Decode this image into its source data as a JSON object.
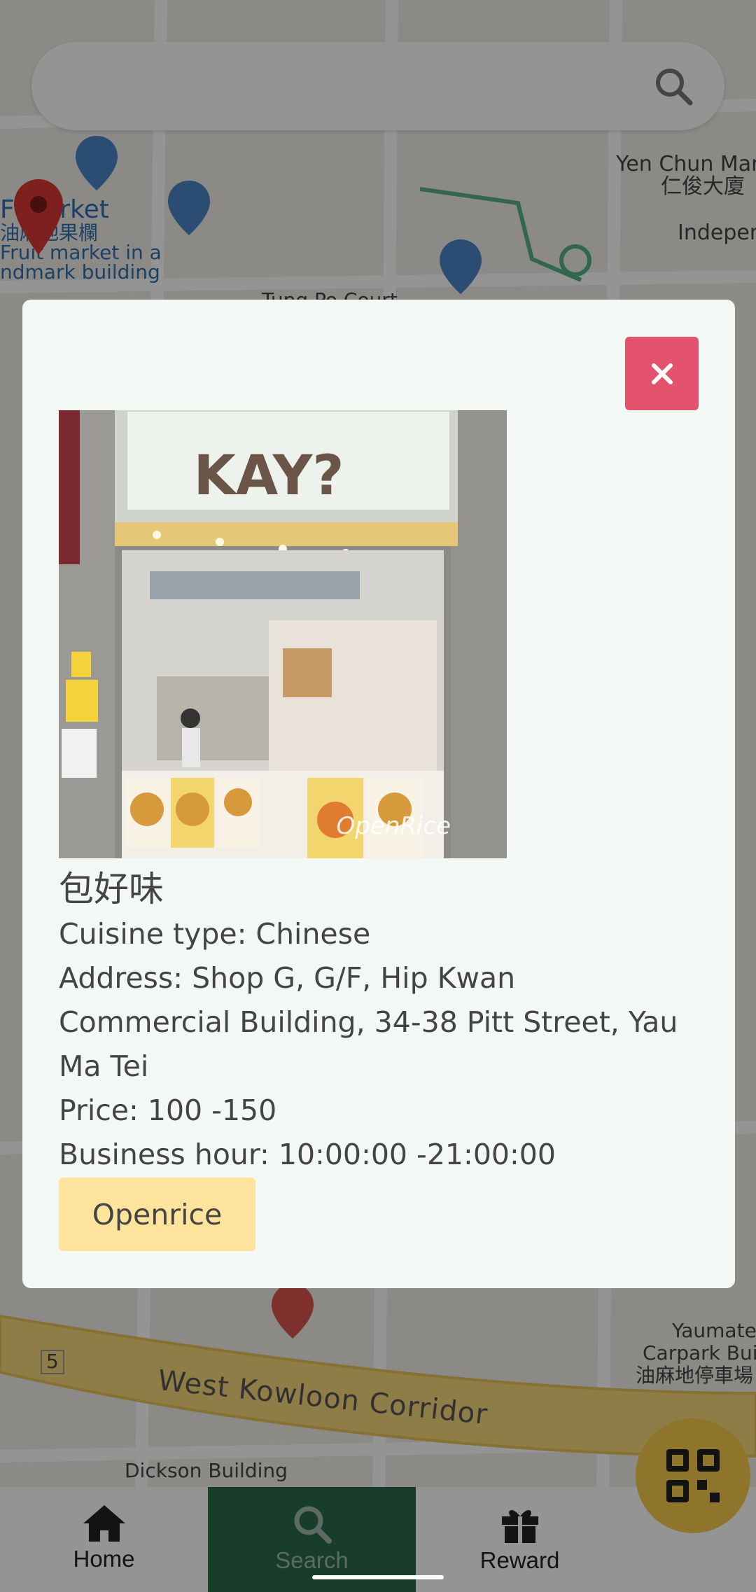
{
  "map": {
    "labels": [
      {
        "id": "market-en",
        "text": "F Market"
      },
      {
        "id": "market-zh",
        "text": "油麻地果欄"
      },
      {
        "id": "market-desc1",
        "text": "Fruit market in a"
      },
      {
        "id": "market-desc2",
        "text": "ndmark building"
      },
      {
        "id": "yen-chun-en",
        "text": "Yen Chun Mans"
      },
      {
        "id": "yen-chun-zh",
        "text": "仁俊大廈"
      },
      {
        "id": "independ",
        "text": "Independ"
      },
      {
        "id": "tung-po",
        "text": "Tung Po Court"
      },
      {
        "id": "yaumatei-1",
        "text": "Yaumate"
      },
      {
        "id": "yaumatei-2",
        "text": "Carpark Buil"
      },
      {
        "id": "yaumatei-3",
        "text": "油麻地停車場"
      },
      {
        "id": "dickson",
        "text": "Dickson Building"
      },
      {
        "id": "corridor",
        "text": "West Kowloon Corridor"
      },
      {
        "id": "route-5",
        "text": "5"
      }
    ]
  },
  "search": {
    "placeholder": ""
  },
  "modal": {
    "close_icon": "close-icon",
    "photo": {
      "sign_text": "KAY?",
      "watermark": "OpenRice"
    },
    "name": "包好味",
    "cuisine": "Cuisine type: Chinese",
    "address": "Address: Shop G, G/F, Hip Kwan Commercial Building, 34-38 Pitt Street, Yau Ma Tei",
    "price": "Price: 100 -150",
    "hours": "Business hour: 10:00:00 -21:00:00",
    "openrice_button": "Openrice"
  },
  "nav": {
    "items": [
      {
        "label": "Home",
        "icon": "home-icon",
        "active": false
      },
      {
        "label": "Search",
        "icon": "search-icon",
        "active": true
      },
      {
        "label": "Reward",
        "icon": "gift-icon",
        "active": false
      }
    ],
    "fab_icon": "qr-code-icon"
  },
  "colors": {
    "modal_bg": "#f3f8f5",
    "close_button": "#e3536e",
    "openrice_button": "#fde39b",
    "nav_active": "#2b6a4a",
    "fab": "#f6c84a"
  }
}
